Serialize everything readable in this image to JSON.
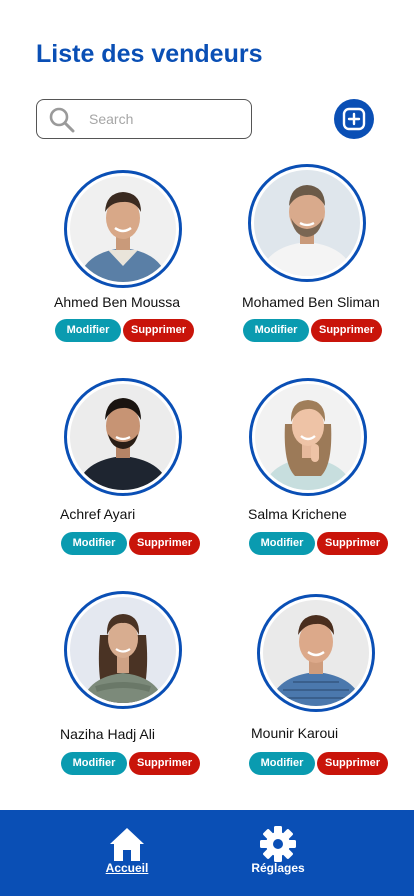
{
  "header": {
    "title": "Liste des vendeurs"
  },
  "search": {
    "placeholder": "Search",
    "value": ""
  },
  "actions": {
    "add_icon": "plus-square-icon"
  },
  "buttons": {
    "edit_label": "Modifier",
    "delete_label": "Supprimer"
  },
  "sellers": [
    {
      "name": "Ahmed Ben Moussa"
    },
    {
      "name": "Mohamed Ben Sliman"
    },
    {
      "name": "Achref Ayari"
    },
    {
      "name": "Salma Krichene"
    },
    {
      "name": "Naziha Hadj Ali"
    },
    {
      "name": "Mounir Karoui"
    }
  ],
  "nav": [
    {
      "label": "Accueil",
      "icon": "home-icon",
      "active": true
    },
    {
      "label": "Réglages",
      "icon": "gear-icon",
      "active": false
    }
  ],
  "colors": {
    "primary": "#0a4fb5",
    "edit": "#0a9bb0",
    "delete": "#c9140a"
  }
}
